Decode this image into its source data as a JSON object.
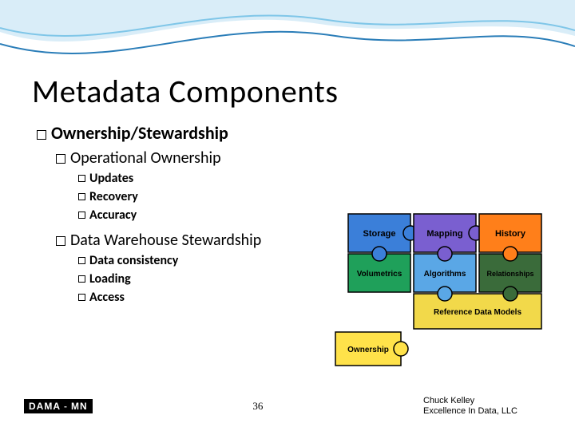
{
  "title": "Metadata Components",
  "section1": {
    "heading": "Ownership/Stewardship",
    "sub1": {
      "heading": "Operational Ownership",
      "items": [
        "Updates",
        "Recovery",
        "Accuracy"
      ]
    },
    "sub2": {
      "heading": "Data Warehouse Stewardship",
      "items": [
        "Data consistency",
        "Loading",
        "Access"
      ]
    }
  },
  "puzzle": {
    "pieces": [
      "Storage",
      "Mapping",
      "History",
      "Volumetrics",
      "Algorithms",
      "Relationships",
      "Reference Data Models",
      "Ownership"
    ]
  },
  "footer": {
    "logo_left": "DAMA",
    "logo_right": "MN",
    "page": "36",
    "credit_line1": "Chuck Kelley",
    "credit_line2": "Excellence In Data, LLC"
  }
}
